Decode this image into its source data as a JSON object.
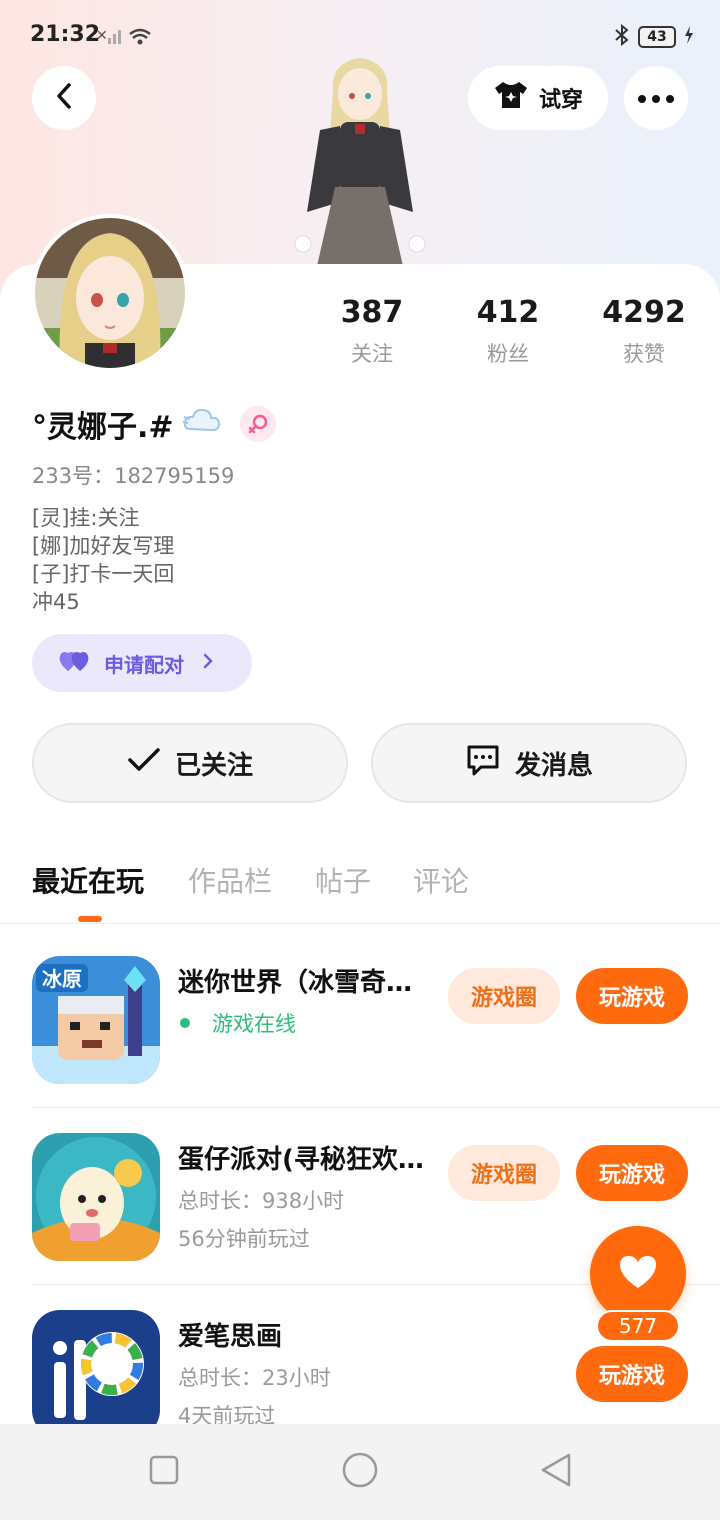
{
  "status_bar": {
    "time": "21:32",
    "battery": "43"
  },
  "header": {
    "try_on_label": "试穿"
  },
  "profile": {
    "stats": [
      {
        "value": "387",
        "label": "关注"
      },
      {
        "value": "412",
        "label": "粉丝"
      },
      {
        "value": "4292",
        "label": "获赞"
      }
    ],
    "nickname": "°灵娜子.#",
    "uid": "233号：182795159",
    "bio": [
      "[灵]挂:关注",
      "[娜]加好友写理",
      "[子]打卡一天回",
      "冲45"
    ],
    "pair_label": "申请配对"
  },
  "actions": {
    "follow_label": "已关注",
    "message_label": "发消息"
  },
  "tabs": [
    "最近在玩",
    "作品栏",
    "帖子",
    "评论"
  ],
  "games": [
    {
      "title": "迷你世界（冰雪奇…",
      "status": "游戏在线",
      "circle_label": "游戏圈",
      "play_label": "玩游戏"
    },
    {
      "title": "蛋仔派对(寻秘狂欢…",
      "duration": "总时长：938小时",
      "last_played": "56分钟前玩过",
      "circle_label": "游戏圈",
      "play_label": "玩游戏"
    },
    {
      "title": "爱笔思画",
      "duration": "总时长：23小时",
      "last_played": "4天前玩过",
      "play_label": "玩游戏"
    }
  ],
  "like": {
    "count": "577"
  },
  "colors": {
    "accent": "#ff6a0e",
    "online": "#2cbf7b",
    "pair": "#6c5ce0"
  }
}
